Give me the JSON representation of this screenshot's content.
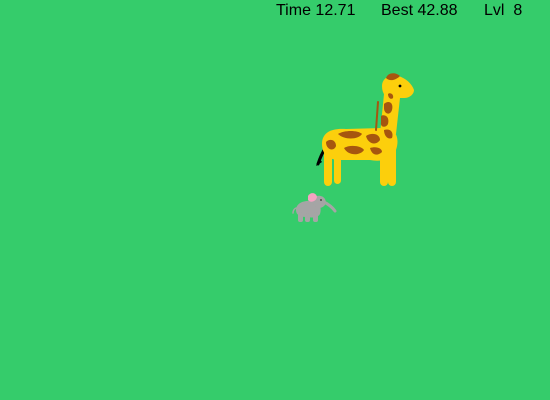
{
  "hud": {
    "time_label": "Time",
    "time_value": "12.71",
    "best_label": "Best",
    "best_value": "42.88",
    "level_label": "Lvl",
    "level_value": "8"
  },
  "sprites": {
    "giraffe": {
      "icon": "giraffe-icon",
      "body_color": "#fccf0c",
      "spot_color": "#a6560f",
      "mane_color": "#000000"
    },
    "elephant": {
      "icon": "elephant-icon",
      "body_color": "#a5a5a5",
      "ear_color": "#f4a3c1"
    }
  },
  "colors": {
    "background": "#35cc6b",
    "hud_text": "#000000"
  }
}
